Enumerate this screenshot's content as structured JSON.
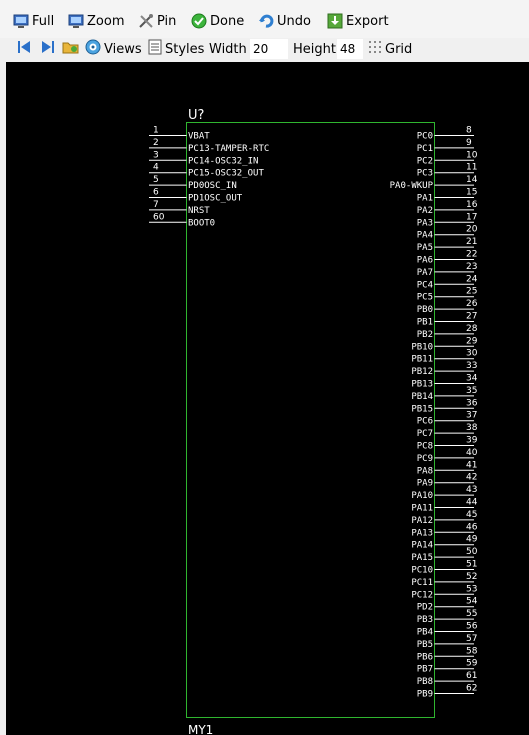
{
  "toolbar": {
    "full": "Full",
    "zoom": "Zoom",
    "pin": "Pin",
    "done": "Done",
    "undo": "Undo",
    "export": "Export"
  },
  "toolbar2": {
    "views": "Views",
    "styles": "Styles",
    "width_label": "Width",
    "width_value": "20",
    "height_label": "Height",
    "height_value": "48",
    "grid": "Grid"
  },
  "component": {
    "reference": "U?",
    "value": "MY1",
    "left_pins": [
      {
        "num": "1",
        "name": "VBAT"
      },
      {
        "num": "2",
        "name": "PC13-TAMPER-RTC"
      },
      {
        "num": "3",
        "name": "PC14-OSC32_IN"
      },
      {
        "num": "4",
        "name": "PC15-OSC32_OUT"
      },
      {
        "num": "5",
        "name": "PD0OSC_IN"
      },
      {
        "num": "6",
        "name": "PD1OSC_OUT"
      },
      {
        "num": "7",
        "name": "NRST"
      },
      {
        "num": "60",
        "name": "BOOT0"
      }
    ],
    "right_pins": [
      {
        "num": "8",
        "name": "PC0"
      },
      {
        "num": "9",
        "name": "PC1"
      },
      {
        "num": "10",
        "name": "PC2"
      },
      {
        "num": "11",
        "name": "PC3"
      },
      {
        "num": "14",
        "name": "PA0-WKUP"
      },
      {
        "num": "15",
        "name": "PA1"
      },
      {
        "num": "16",
        "name": "PA2"
      },
      {
        "num": "17",
        "name": "PA3"
      },
      {
        "num": "20",
        "name": "PA4"
      },
      {
        "num": "21",
        "name": "PA5"
      },
      {
        "num": "22",
        "name": "PA6"
      },
      {
        "num": "23",
        "name": "PA7"
      },
      {
        "num": "24",
        "name": "PC4"
      },
      {
        "num": "25",
        "name": "PC5"
      },
      {
        "num": "26",
        "name": "PB0"
      },
      {
        "num": "27",
        "name": "PB1"
      },
      {
        "num": "28",
        "name": "PB2"
      },
      {
        "num": "29",
        "name": "PB10"
      },
      {
        "num": "30",
        "name": "PB11"
      },
      {
        "num": "33",
        "name": "PB12"
      },
      {
        "num": "34",
        "name": "PB13"
      },
      {
        "num": "35",
        "name": "PB14"
      },
      {
        "num": "36",
        "name": "PB15"
      },
      {
        "num": "37",
        "name": "PC6"
      },
      {
        "num": "38",
        "name": "PC7"
      },
      {
        "num": "39",
        "name": "PC8"
      },
      {
        "num": "40",
        "name": "PC9"
      },
      {
        "num": "41",
        "name": "PA8"
      },
      {
        "num": "42",
        "name": "PA9"
      },
      {
        "num": "43",
        "name": "PA10"
      },
      {
        "num": "44",
        "name": "PA11"
      },
      {
        "num": "45",
        "name": "PA12"
      },
      {
        "num": "46",
        "name": "PA13"
      },
      {
        "num": "49",
        "name": "PA14"
      },
      {
        "num": "50",
        "name": "PA15"
      },
      {
        "num": "51",
        "name": "PC10"
      },
      {
        "num": "52",
        "name": "PC11"
      },
      {
        "num": "53",
        "name": "PC12"
      },
      {
        "num": "54",
        "name": "PD2"
      },
      {
        "num": "55",
        "name": "PB3"
      },
      {
        "num": "56",
        "name": "PB4"
      },
      {
        "num": "57",
        "name": "PB5"
      },
      {
        "num": "58",
        "name": "PB6"
      },
      {
        "num": "59",
        "name": "PB7"
      },
      {
        "num": "61",
        "name": "PB8"
      },
      {
        "num": "62",
        "name": "PB9"
      }
    ]
  },
  "colors": {
    "canvas_bg": "#000000",
    "body_outline": "#2fb52f",
    "pin_line": "#ffffff",
    "text": "#ffffff"
  }
}
